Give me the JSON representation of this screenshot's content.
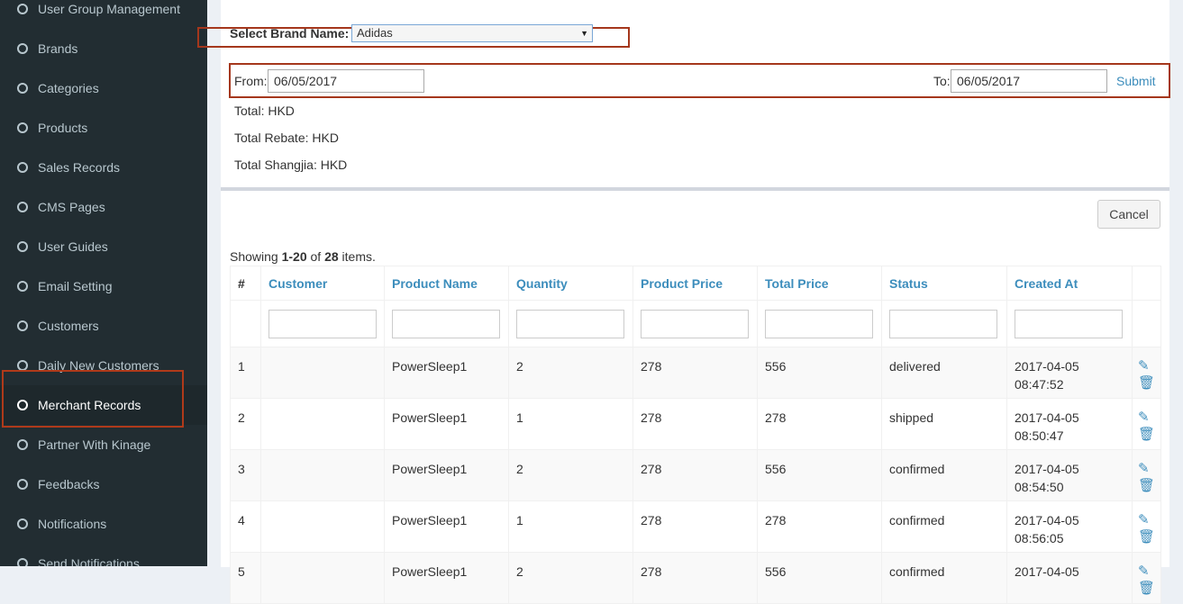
{
  "sidebar": {
    "items": [
      {
        "label": "User Group Management"
      },
      {
        "label": "Brands"
      },
      {
        "label": "Categories"
      },
      {
        "label": "Products"
      },
      {
        "label": "Sales Records"
      },
      {
        "label": "CMS Pages"
      },
      {
        "label": "User Guides"
      },
      {
        "label": "Email Setting"
      },
      {
        "label": "Customers"
      },
      {
        "label": "Daily New Customers"
      },
      {
        "label": "Merchant Records"
      },
      {
        "label": "Partner With Kinage"
      },
      {
        "label": "Feedbacks"
      },
      {
        "label": "Notifications"
      },
      {
        "label": "Send Notifications"
      }
    ],
    "active_index": 10
  },
  "filter": {
    "brand_label": "Select Brand Name:",
    "brand_value": "Adidas",
    "from_label": "From:",
    "from_value": "06/05/2017",
    "to_label": "To:",
    "to_value": "06/05/2017",
    "submit_label": "Submit"
  },
  "totals": {
    "total": "Total:  HKD",
    "rebate": "Total Rebate:  HKD",
    "shangjia": "Total Shangjia:  HKD"
  },
  "grid": {
    "cancel_label": "Cancel",
    "showing_prefix": "Showing ",
    "showing_range": "1-20",
    "showing_of": " of ",
    "showing_total": "28",
    "showing_suffix": " items.",
    "columns": [
      "#",
      "Customer",
      "Product Name",
      "Quantity",
      "Product Price",
      "Total Price",
      "Status",
      "Created At"
    ],
    "rows": [
      {
        "num": "1",
        "customer": "",
        "product": "PowerSleep1",
        "qty": "2",
        "price": "278",
        "total": "556",
        "status": "delivered",
        "date": "2017-04-05",
        "time": "08:47:52"
      },
      {
        "num": "2",
        "customer": "",
        "product": "PowerSleep1",
        "qty": "1",
        "price": "278",
        "total": "278",
        "status": "shipped",
        "date": "2017-04-05",
        "time": "08:50:47"
      },
      {
        "num": "3",
        "customer": "",
        "product": "PowerSleep1",
        "qty": "2",
        "price": "278",
        "total": "556",
        "status": "confirmed",
        "date": "2017-04-05",
        "time": "08:54:50"
      },
      {
        "num": "4",
        "customer": "",
        "product": "PowerSleep1",
        "qty": "1",
        "price": "278",
        "total": "278",
        "status": "confirmed",
        "date": "2017-04-05",
        "time": "08:56:05"
      },
      {
        "num": "5",
        "customer": "",
        "product": "PowerSleep1",
        "qty": "2",
        "price": "278",
        "total": "556",
        "status": "confirmed",
        "date": "2017-04-05",
        "time": ""
      }
    ],
    "icons": {
      "edit": "pencil-icon",
      "delete": "trash-icon"
    }
  },
  "colors": {
    "sidebar_bg": "#222d32",
    "link": "#3c8dbc",
    "highlight": "#a5371c"
  }
}
